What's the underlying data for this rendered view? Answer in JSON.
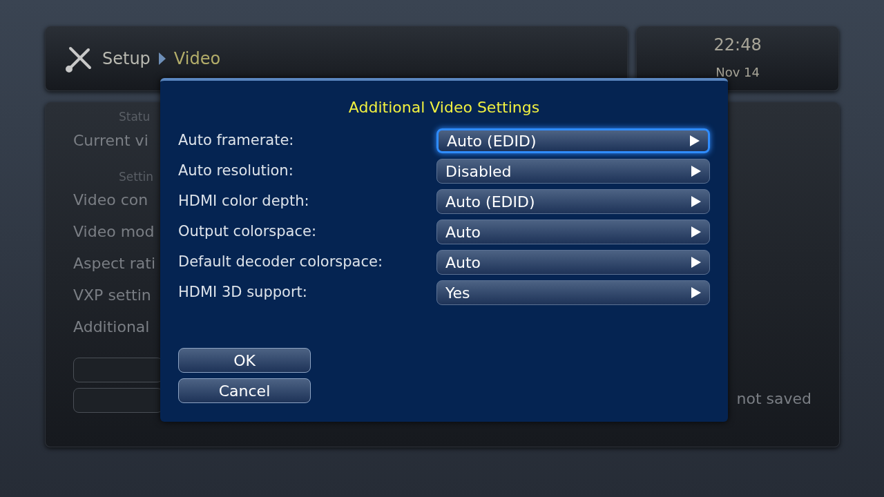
{
  "header": {
    "breadcrumb": [
      "Setup",
      "Video"
    ],
    "time": "22:48",
    "date": "Nov 14"
  },
  "background_panel": {
    "status_heading": "Statu",
    "status_items": [
      "Current vi"
    ],
    "settings_heading": "Settin",
    "settings_items": [
      "Video con",
      "Video mod",
      "Aspect rati",
      "VXP settin",
      "Additional"
    ],
    "note": "not saved"
  },
  "dialog": {
    "title": "Additional Video Settings",
    "rows": [
      {
        "label": "Auto framerate:",
        "value": "Auto (EDID)",
        "selected": true
      },
      {
        "label": "Auto resolution:",
        "value": "Disabled",
        "selected": false
      },
      {
        "label": "HDMI color depth:",
        "value": "Auto (EDID)",
        "selected": false
      },
      {
        "label": "Output colorspace:",
        "value": "Auto",
        "selected": false
      },
      {
        "label": "Default decoder colorspace:",
        "value": "Auto",
        "selected": false
      },
      {
        "label": "HDMI 3D support:",
        "value": "Yes",
        "selected": false
      }
    ],
    "buttons": [
      "OK",
      "Cancel"
    ]
  }
}
